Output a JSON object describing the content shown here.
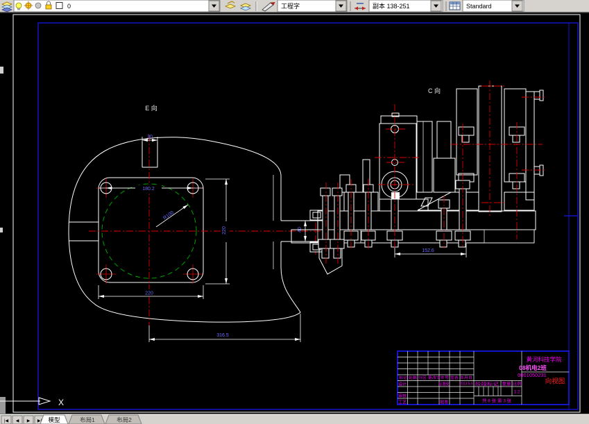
{
  "toolbar": {
    "layer_combo": {
      "value": "0"
    },
    "text_style_combo": {
      "value": "工程字"
    },
    "dim_style_combo": {
      "value": "副本 138-251"
    },
    "table_style_combo": {
      "value": "Standard"
    }
  },
  "drawing": {
    "view_e": {
      "label": "E 向",
      "dim_boss_width": "30",
      "dim_bolt_spacing": "180.2",
      "dim_radius": "R100",
      "dim_square_width": "220",
      "dim_square_height": "220",
      "dim_overall": "316.5",
      "dim_shaft": "40"
    },
    "view_c": {
      "label": "C 向",
      "dim_span": "152.6"
    },
    "ucs_axis_label": "X"
  },
  "title_block": {
    "school": "黄河科技学院",
    "class_name": "08机电2班",
    "drawing_no": "0801050231",
    "title": "向视图",
    "rev_header": "标记 处数 分区 更改文件号 签名 年月日",
    "design_label": "设计",
    "standard_label": "标准化",
    "date": "2013.5.5",
    "stage_label": "阶段标记",
    "weight_label": "重量",
    "scale_label": "比例",
    "scale_value": "1:2",
    "audit_label": "审核",
    "process_label": "工艺",
    "approve_label": "批准",
    "sheet_info": "共 8 张 第 3 张"
  },
  "tabs": {
    "nav": [
      "|◀",
      "◀",
      "▶",
      "▶|"
    ],
    "items": [
      {
        "label": "模型"
      },
      {
        "label": "布局1"
      },
      {
        "label": "布局2"
      }
    ]
  },
  "colors": {
    "background": "#000000",
    "toolbar_bg": "#d6d3ce",
    "frame_blue": "#1414c8",
    "line_white": "#ffffff",
    "centerline_red": "#e00000",
    "circle_green": "#00a000",
    "dim_text_blue": "#6a6aff",
    "title_magenta": "#f000f0",
    "title_red": "#ff2020"
  }
}
